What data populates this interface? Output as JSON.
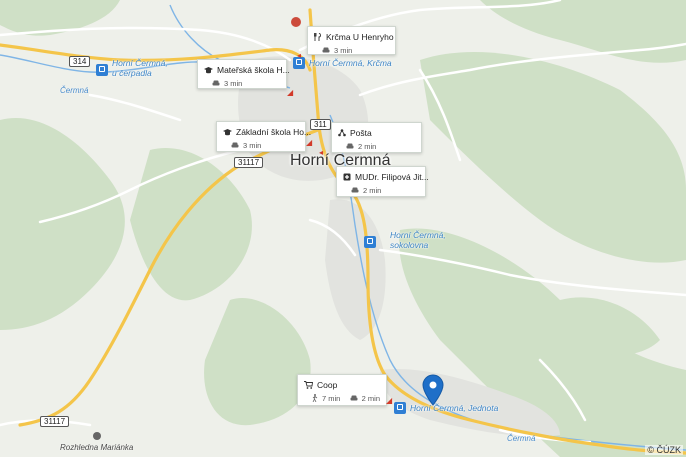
{
  "map": {
    "town_name": "Horní Čermná",
    "copyright": "© ČÚZK",
    "colors": {
      "water": "#7fb5e6",
      "road_major": "#f4c54a",
      "road_minor": "#ffffff",
      "forest": "#cfe0c6",
      "bus_stop": "#2f7fd4",
      "marker": "#1f6fc8"
    }
  },
  "roads": {
    "r314": "314",
    "r311": "311",
    "r31117_a": "31117",
    "r31117_b": "31117"
  },
  "callouts": [
    {
      "name": "Krčma U Henryho",
      "icon": "restaurant-icon",
      "times": [
        "3 min"
      ]
    },
    {
      "name": "Mateřská škola H...",
      "icon": "school-icon",
      "times": [
        "3 min"
      ]
    },
    {
      "name": "Základní škola Ho...",
      "icon": "school-icon",
      "times": [
        "3 min"
      ]
    },
    {
      "name": "Pošta",
      "icon": "post-icon",
      "times": [
        "2 min"
      ]
    },
    {
      "name": "MUDr. Filipová Jit...",
      "icon": "medical-icon",
      "times": [
        "2 min"
      ]
    },
    {
      "name": "Coop",
      "icon": "shopping-cart-icon",
      "times": [
        "7 min",
        "2 min"
      ]
    }
  ],
  "bus_stops": [
    "Horní Čermná, u čerpadla",
    "Horní Čermná, Krčma",
    "Horní Čermná, sokolovna",
    "Horní Čermná, Jednota"
  ],
  "bus_stop_lines": {
    "cerpadla": [
      "Horní Čermná,",
      "u čerpadla"
    ],
    "krcma": [
      "Horní Čermná, Krčma"
    ],
    "sokolovna": [
      "Horní Čermná,",
      "sokolovna"
    ],
    "jednota": [
      "Horní Čermná, Jednota"
    ]
  },
  "streams": [
    "Čermná",
    "Čermná"
  ],
  "pois": {
    "rozhledna": "Rozhledna Mariánka"
  }
}
